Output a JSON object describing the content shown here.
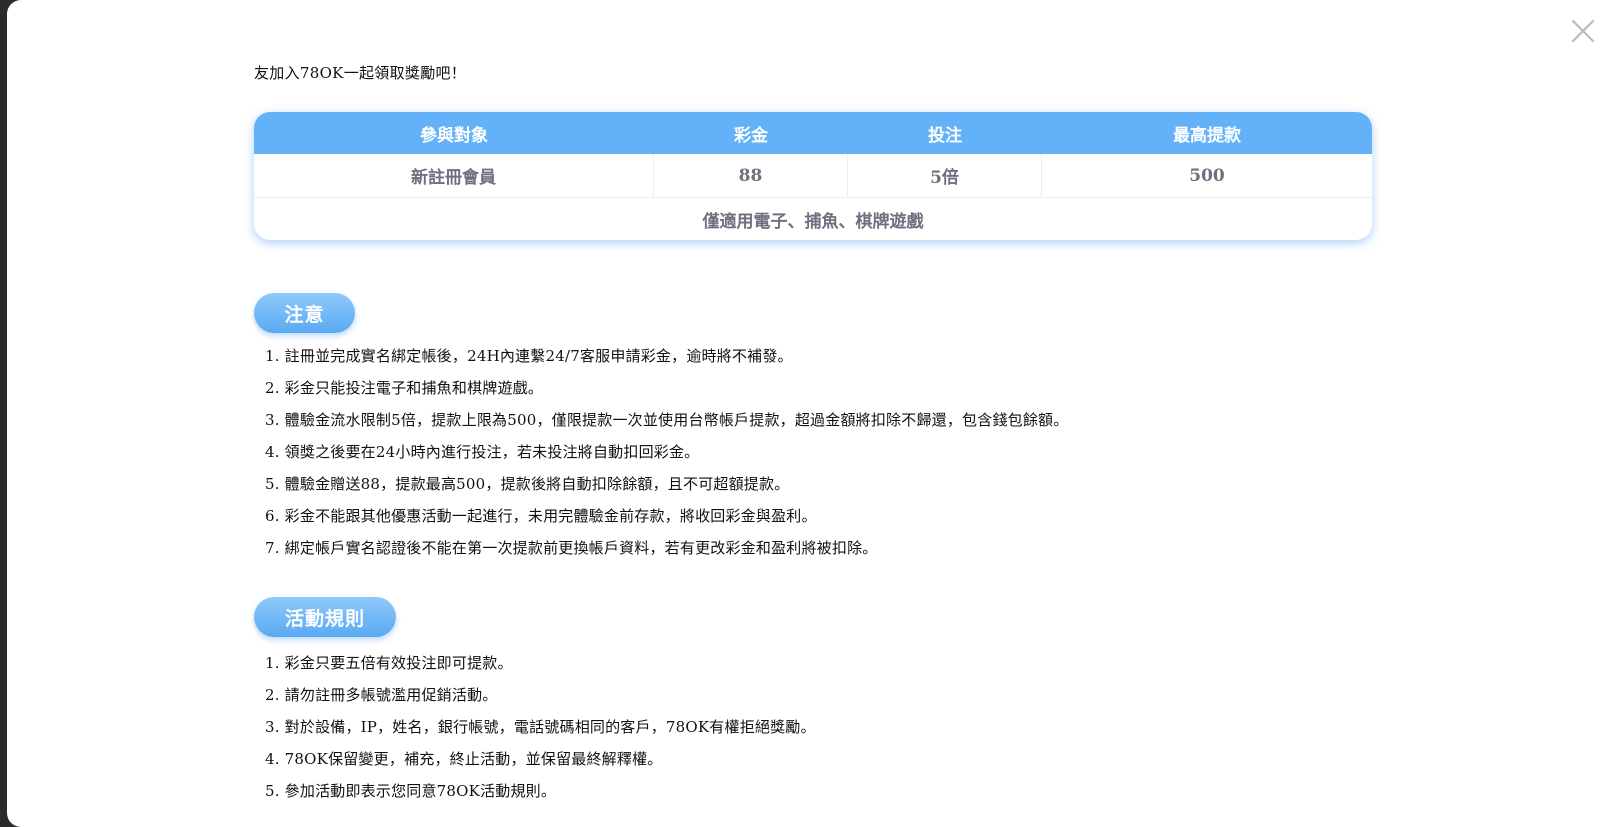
{
  "intro_text": "友加入78OK一起領取獎勵吧！",
  "bonus_table": {
    "headers": [
      "參與對象",
      "彩金",
      "投注",
      "最高提款"
    ],
    "row": [
      "新註冊會員",
      "88",
      "5倍",
      "500"
    ],
    "footer": "僅適用電子、捕魚、棋牌遊戲"
  },
  "notice": {
    "title": "注意",
    "items": [
      "1. 註冊並完成實名綁定帳後，24H內連繫24/7客服申請彩金，逾時將不補發。",
      "2. 彩金只能投注電子和捕魚和棋牌遊戲。",
      "3. 體驗金流水限制5倍，提款上限為500，僅限提款一次並使用台幣帳戶提款，超過金額將扣除不歸還，包含錢包餘額。",
      "4. 領獎之後要在24小時內進行投注，若未投注將自動扣回彩金。",
      "5. 體驗金贈送88，提款最高500，提款後將自動扣除餘額，且不可超額提款。",
      "6. 彩金不能跟其他優惠活動一起進行，未用完體驗金前存款，將收回彩金與盈利。",
      "7. 綁定帳戶實名認證後不能在第一次提款前更換帳戶資料，若有更改彩金和盈利將被扣除。"
    ]
  },
  "rules": {
    "title": "活動規則",
    "items": [
      "1. 彩金只要五倍有效投注即可提款。",
      "2. 請勿註冊多帳號濫用促銷活動。",
      "3. 對於設備，IP，姓名，銀行帳號，電話號碼相同的客戶，78OK有權拒絕獎勵。",
      "4. 78OK保留變更，補充，終止活動，並保留最終解釋權。",
      "5. 參加活動即表示您同意78OK活動規則。"
    ]
  },
  "icons": {
    "close": "close-icon"
  },
  "colors": {
    "accent": "#63b1f7",
    "table_text": "#6f6f7f"
  }
}
